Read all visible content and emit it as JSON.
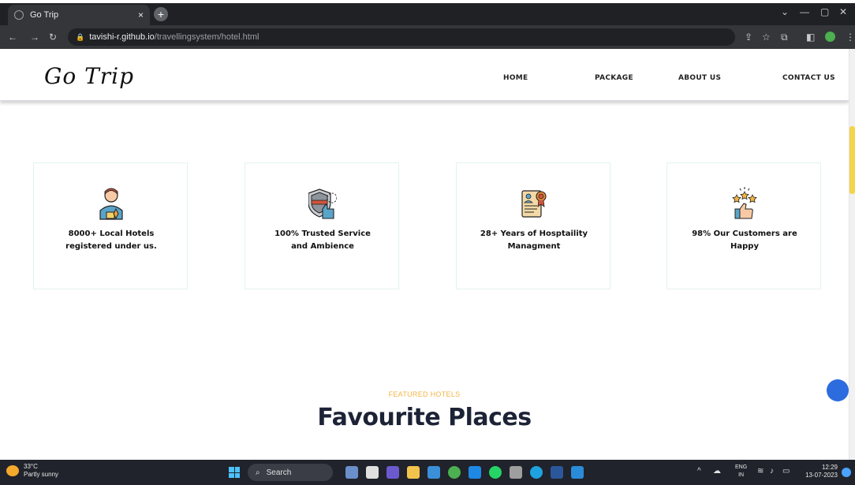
{
  "browser": {
    "tab_title": "Go Trip",
    "tab_close": "×",
    "new_tab": "+",
    "url_host": "tavishi-r.github.io",
    "url_path": "/travellingsystem/hotel.html"
  },
  "header": {
    "logo": "Go Trip",
    "nav": [
      "HOME",
      "PACKAGE",
      "ABOUT US",
      "CONTACT US"
    ]
  },
  "cards": [
    {
      "text": "8000+ Local Hotels registered under us.",
      "icon": "hotel-staff-icon"
    },
    {
      "text": "100% Trusted Service and Ambience",
      "icon": "shield-thumb-icon"
    },
    {
      "text": "28+ Years of Hosptaility Managment",
      "icon": "certificate-icon"
    },
    {
      "text": "98% Our Customers are Happy",
      "icon": "stars-thumb-icon"
    }
  ],
  "featured": {
    "subtitle": "FEATURED HOTELS",
    "title": "Favourite Places"
  },
  "taskbar": {
    "temperature": "33°C",
    "weather": "Partly sunny",
    "search": "Search",
    "lang_top": "ENG",
    "lang_bottom": "IN",
    "time": "12:29",
    "date": "13-07-2023"
  },
  "colors": {
    "accent": "#f2b544",
    "title": "#1d2336",
    "scroll_thumb": "#f5d34a"
  }
}
